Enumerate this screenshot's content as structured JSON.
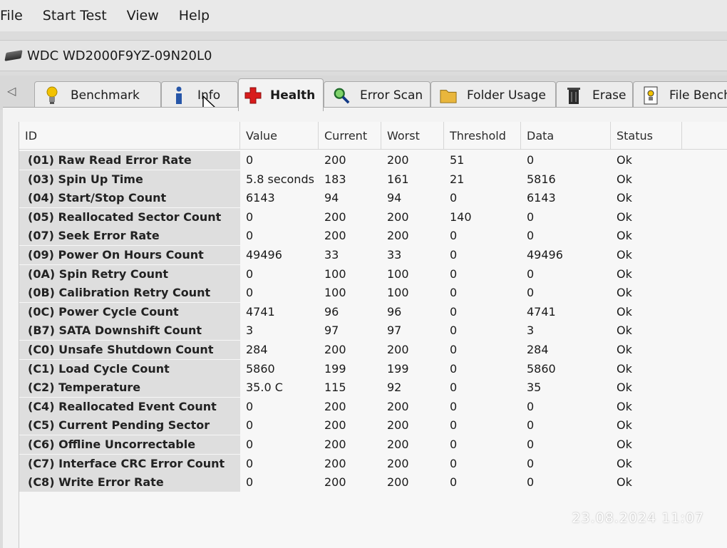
{
  "menu": {
    "items": [
      {
        "label": "File"
      },
      {
        "label": "Start Test"
      },
      {
        "label": "View"
      },
      {
        "label": "Help"
      }
    ]
  },
  "drive": {
    "name": "WDC WD2000F9YZ-09N20L0",
    "icon": "hard-drive-icon"
  },
  "tabs": [
    {
      "label": "Benchmark",
      "icon": "lightbulb-icon"
    },
    {
      "label": "Info",
      "icon": "info-icon"
    },
    {
      "label": "Health",
      "icon": "red-cross-icon",
      "active": true
    },
    {
      "label": "Error Scan",
      "icon": "magnifier-icon"
    },
    {
      "label": "Folder Usage",
      "icon": "folder-icon"
    },
    {
      "label": "Erase",
      "icon": "trash-icon"
    },
    {
      "label": "File Bench",
      "icon": "file-benchmark-icon"
    }
  ],
  "table": {
    "columns": [
      "ID",
      "Value",
      "Current",
      "Worst",
      "Threshold",
      "Data",
      "Status"
    ],
    "rows": [
      [
        "(01) Raw Read Error Rate",
        "0",
        "200",
        "200",
        "51",
        "0",
        "Ok"
      ],
      [
        "(03) Spin Up Time",
        "5.8 seconds",
        "183",
        "161",
        "21",
        "5816",
        "Ok"
      ],
      [
        "(04) Start/Stop Count",
        "6143",
        "94",
        "94",
        "0",
        "6143",
        "Ok"
      ],
      [
        "(05) Reallocated Sector Count",
        "0",
        "200",
        "200",
        "140",
        "0",
        "Ok"
      ],
      [
        "(07) Seek Error Rate",
        "0",
        "200",
        "200",
        "0",
        "0",
        "Ok"
      ],
      [
        "(09) Power On Hours Count",
        "49496",
        "33",
        "33",
        "0",
        "49496",
        "Ok"
      ],
      [
        "(0A) Spin Retry Count",
        "0",
        "100",
        "100",
        "0",
        "0",
        "Ok"
      ],
      [
        "(0B) Calibration Retry Count",
        "0",
        "100",
        "100",
        "0",
        "0",
        "Ok"
      ],
      [
        "(0C) Power Cycle Count",
        "4741",
        "96",
        "96",
        "0",
        "4741",
        "Ok"
      ],
      [
        "(B7) SATA Downshift Count",
        "3",
        "97",
        "97",
        "0",
        "3",
        "Ok"
      ],
      [
        "(C0) Unsafe Shutdown Count",
        "284",
        "200",
        "200",
        "0",
        "284",
        "Ok"
      ],
      [
        "(C1) Load Cycle Count",
        "5860",
        "199",
        "199",
        "0",
        "5860",
        "Ok"
      ],
      [
        "(C2) Temperature",
        "35.0 C",
        "115",
        "92",
        "0",
        "35",
        "Ok"
      ],
      [
        "(C4) Reallocated Event Count",
        "0",
        "200",
        "200",
        "0",
        "0",
        "Ok"
      ],
      [
        "(C5) Current Pending Sector",
        "0",
        "200",
        "200",
        "0",
        "0",
        "Ok"
      ],
      [
        "(C6) Offline Uncorrectable",
        "0",
        "200",
        "200",
        "0",
        "0",
        "Ok"
      ],
      [
        "(C7) Interface CRC Error Count",
        "0",
        "200",
        "200",
        "0",
        "0",
        "Ok"
      ],
      [
        "(C8) Write Error Rate",
        "0",
        "200",
        "200",
        "0",
        "0",
        "Ok"
      ]
    ]
  },
  "photo_timestamp": "23.08.2024  11:07"
}
